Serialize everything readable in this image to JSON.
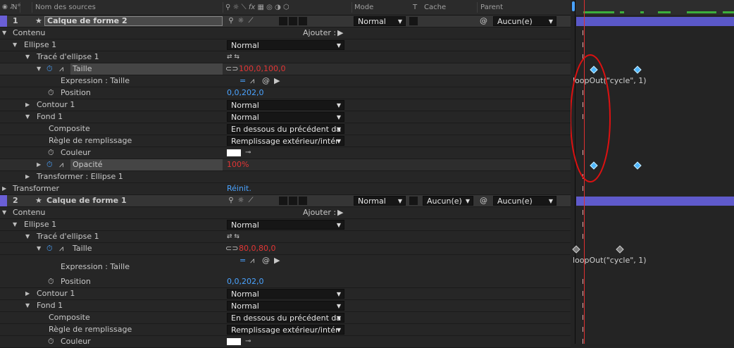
{
  "header": {
    "num": "N°",
    "source_name": "Nom des sources",
    "mode": "Mode",
    "t": "T",
    "cache": "Cache",
    "parent": "Parent"
  },
  "layers": [
    {
      "number": "1",
      "name": "Calque de forme 2",
      "mode": "Normal",
      "parent": "Aucun(e)"
    },
    {
      "number": "2",
      "name": "Calque de forme 1",
      "mode": "Normal",
      "trkmat": "Aucun(e)",
      "parent": "Aucun(e)"
    }
  ],
  "labels": {
    "contenu": "Contenu",
    "ajouter": "Ajouter :",
    "ellipse": "Ellipse 1",
    "trace": "Tracé d'ellipse 1",
    "taille": "Taille",
    "expression": "Expression : Taille",
    "position": "Position",
    "contour": "Contour 1",
    "fond": "Fond 1",
    "composite": "Composite",
    "regle": "Règle de remplissage",
    "couleur": "Couleur",
    "opacite": "Opacité",
    "transformer_ellipse": "Transformer : Ellipse 1",
    "transformer": "Transformer",
    "reinit": "Réinit."
  },
  "values": {
    "mode_normal": "Normal",
    "composite": "En dessous du précédent da",
    "regle": "Remplissage extérieur/intér",
    "position": "0,0,202,0",
    "opacite": "100%"
  },
  "layer1_values": {
    "taille": "100,0,100,0"
  },
  "layer2_values": {
    "taille": "80,0,80,0"
  },
  "timeline": {
    "expression": "loopOut(\"cycle\",  1)"
  },
  "colors": {
    "label_color": "#6a5fd6",
    "value_red": "#e23535",
    "value_blue": "#4aa3ff",
    "keyframe_blue": "#4fb7ff",
    "playhead": "#e03030",
    "annotation_circle": "#dd1111"
  }
}
